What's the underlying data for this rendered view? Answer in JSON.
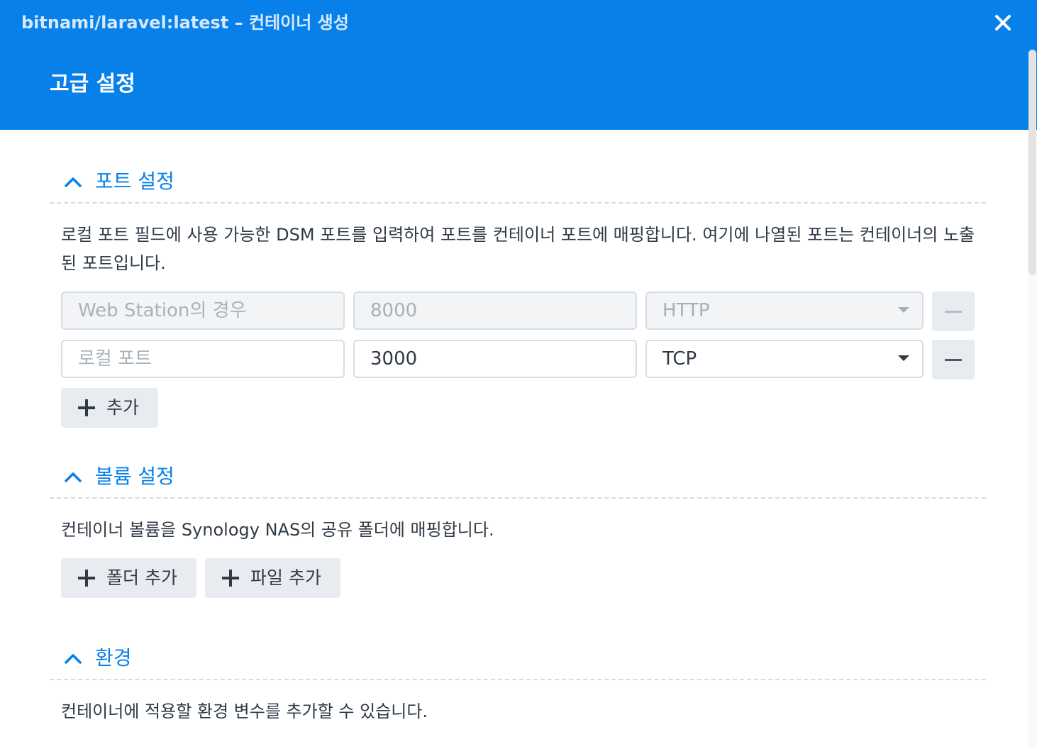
{
  "window": {
    "title": "bitnami/laravel:latest – 컨테이너 생성",
    "close_label": "X"
  },
  "page": {
    "title": "고급 설정"
  },
  "colors": {
    "accent": "#0780ea",
    "header_bg": "#0780ea"
  },
  "port_section": {
    "title": "포트 설정",
    "description": "로컬 포트 필드에 사용 가능한 DSM 포트를 입력하여 포트를 컨테이너 포트에 매핑합니다. 여기에 나열된 포트는 컨테이너의 노출된 포트입니다.",
    "rows": [
      {
        "local_port_placeholder": "Web Station의 경우",
        "container_port": "8000",
        "protocol": "HTTP",
        "disabled": true
      },
      {
        "local_port_placeholder": "로컬 포트",
        "container_port": "3000",
        "protocol": "TCP",
        "disabled": false
      }
    ],
    "add_label": "추가"
  },
  "volume_section": {
    "title": "볼륨 설정",
    "description": "컨테이너 볼륨을 Synology NAS의 공유 폴더에 매핑합니다.",
    "add_folder_label": "폴더 추가",
    "add_file_label": "파일 추가"
  },
  "env_section": {
    "title": "환경",
    "description": "컨테이너에 적용할 환경 변수를 추가할 수 있습니다."
  }
}
